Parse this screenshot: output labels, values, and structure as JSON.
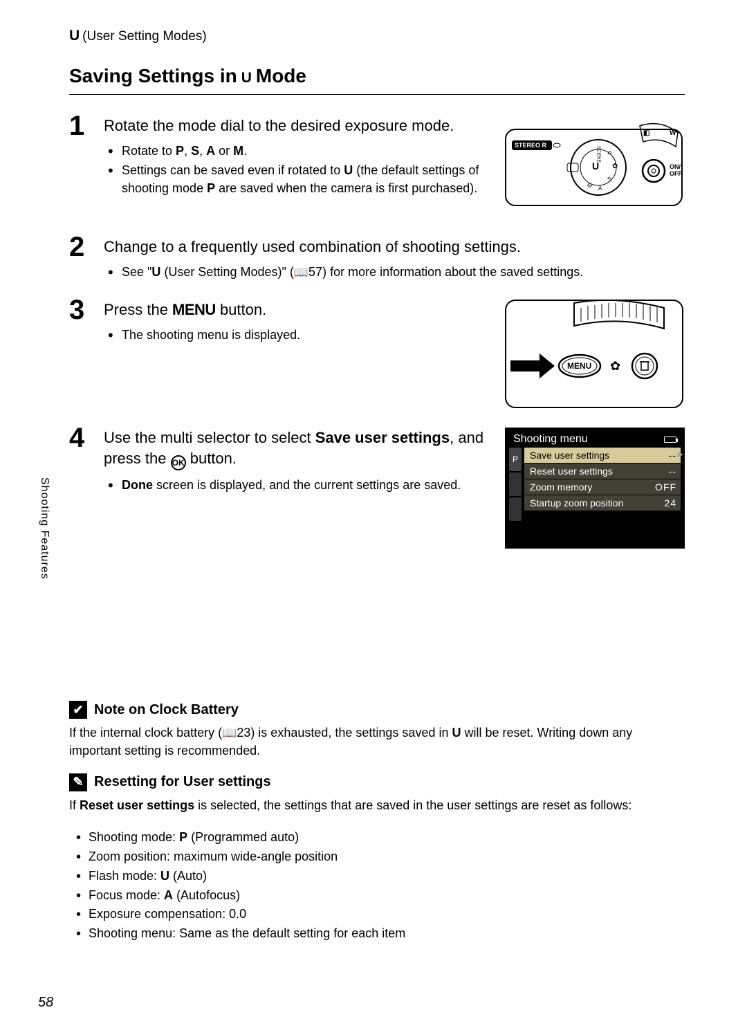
{
  "header": {
    "symbol": "U",
    "label": "(User Setting Modes)"
  },
  "title": {
    "prefix": "Saving Settings in ",
    "symbol": "U",
    "suffix": " Mode"
  },
  "steps": [
    {
      "num": "1",
      "head": "Rotate the mode dial to the desired exposure mode.",
      "bullets": [
        {
          "pre": "Rotate to ",
          "sym1": "P",
          "mid1": ", ",
          "sym2": "S",
          "mid2": ", ",
          "sym3": "A",
          "mid3": " or ",
          "sym4": "M",
          "post": "."
        },
        {
          "pre": "Settings can be saved even if rotated to ",
          "sym1": "U",
          "mid1": " (the default settings of shooting mode ",
          "sym2": "P",
          "post": " are saved when the camera is first purchased)."
        }
      ]
    },
    {
      "num": "2",
      "head": "Change to a frequently used combination of shooting settings.",
      "bullets": [
        {
          "pre": "See \"",
          "sym1": "U",
          "mid1": " (User Setting Modes)\" (",
          "bookref": "57",
          "post": ") for more information about the saved settings."
        }
      ]
    },
    {
      "num": "3",
      "head_pre": "Press the ",
      "head_menu": "MENU",
      "head_post": " button.",
      "bullets": [
        {
          "pre": "The shooting menu is displayed."
        }
      ]
    },
    {
      "num": "4",
      "head_pre": "Use the multi selector to select ",
      "head_bold": "Save user settings",
      "head_mid": ", and press the ",
      "head_ok": "OK",
      "head_post": " button.",
      "bullets": [
        {
          "bold": "Done",
          "post": " screen is displayed, and the current settings are saved."
        }
      ]
    }
  ],
  "shooting_menu": {
    "title": "Shooting menu",
    "tab_letter": "P",
    "rows": [
      {
        "label": "Save user settings",
        "value": "--",
        "selected": true
      },
      {
        "label": "Reset user settings",
        "value": "--"
      },
      {
        "label": "Zoom memory",
        "value": "OFF"
      },
      {
        "label": "Startup zoom position",
        "value": "24"
      }
    ]
  },
  "note1": {
    "icon": "✔",
    "title": "Note on Clock Battery",
    "pre": "If the internal clock battery (",
    "bookref": "23",
    "mid": ") is exhausted, the settings saved in ",
    "sym": "U",
    "post": " will be reset. Writing down any important setting is recommended."
  },
  "note2": {
    "icon": "✎",
    "title": "Resetting for User settings",
    "intro_pre": "If ",
    "intro_bold": "Reset user settings",
    "intro_post": " is selected, the settings that are saved in the user settings are reset as follows:",
    "items": [
      {
        "pre": "Shooting mode: ",
        "sym": "P",
        "post": " (Programmed auto)"
      },
      {
        "pre": "Zoom position: maximum wide-angle position"
      },
      {
        "pre": "Flash mode: ",
        "sym": "U",
        "post": "     (Auto)"
      },
      {
        "pre": "Focus mode: ",
        "sym": "A",
        "post": "   (Autofocus)"
      },
      {
        "pre": "Exposure compensation: 0.0"
      },
      {
        "pre": "Shooting menu: Same as the default setting for each item"
      }
    ]
  },
  "side_tab": "Shooting Features",
  "page_number": "58",
  "illus": {
    "top_labels": {
      "stereo": "STEREO R",
      "w": "W",
      "u": "U",
      "scene": "SCENE",
      "onoff": "ON/\nOFF"
    },
    "back_labels": {
      "menu": "MENU"
    }
  }
}
